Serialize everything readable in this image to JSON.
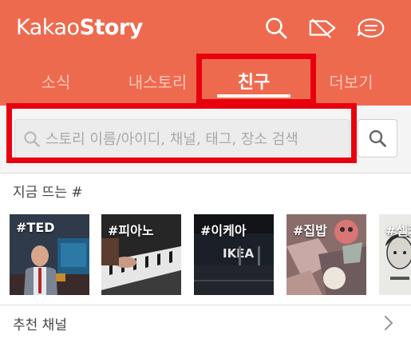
{
  "app": {
    "brand_part1": "Kakao",
    "brand_part2": "Story"
  },
  "header_icons": [
    "search-icon",
    "tag-icon",
    "menu-icon"
  ],
  "tabs": [
    {
      "label": "소식",
      "active": false
    },
    {
      "label": "내스토리",
      "active": false
    },
    {
      "label": "친구",
      "active": true
    },
    {
      "label": "더보기",
      "active": false
    }
  ],
  "search": {
    "placeholder": "스토리 이름/아이디, 채널, 태그, 장소 검색",
    "value": ""
  },
  "trending": {
    "title": "지금 뜨는 #",
    "items": [
      {
        "tag": "#TED"
      },
      {
        "tag": "#피아노"
      },
      {
        "tag": "#이케아"
      },
      {
        "tag": "#집밥"
      },
      {
        "tag": "#셀카"
      }
    ]
  },
  "recommended": {
    "label": "추천 채널"
  },
  "colors": {
    "brand": "#ee6a4f",
    "highlight": "#e8000f"
  }
}
